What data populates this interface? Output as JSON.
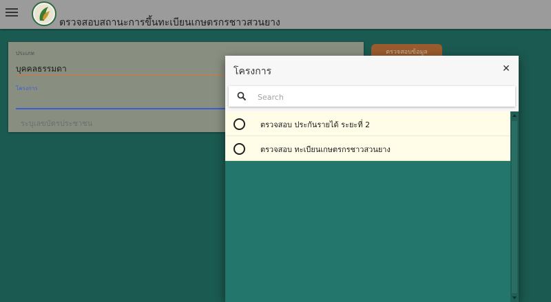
{
  "header": {
    "title": "ตรวจสอบสถานะการขึ้นทะเบียนเกษตรกรชาวสวนยาง",
    "menu_icon": "hamburger-icon",
    "logo": "organization-logo"
  },
  "form": {
    "type_label": "ประเภท",
    "type_value": "บุคคลธรรมดา",
    "project_label": "โครงการ",
    "project_value": "",
    "id_placeholder": "ระบุเลขบัตรประชาชน",
    "check_button_label": "ตรวจสอบข้อมูล"
  },
  "dialog": {
    "title": "โครงการ",
    "close_icon": "close-icon",
    "search": {
      "placeholder": "Search",
      "value": ""
    },
    "options": [
      {
        "label": "ตรวจสอบ ประกันรายได้ ระยะที่ 2",
        "selected": false
      },
      {
        "label": "ตรวจสอบ ทะเบียนเกษตรกรชาวสวนยาง",
        "selected": false
      }
    ]
  },
  "colors": {
    "header_bg": "#9b9b9b",
    "page_bg": "#1b5a50",
    "list_bg": "#23766b",
    "option_bg": "#fffde8",
    "accent_orange": "#d27c3a",
    "type_underline": "#e2743a",
    "project_underline": "#3d5bd6"
  }
}
